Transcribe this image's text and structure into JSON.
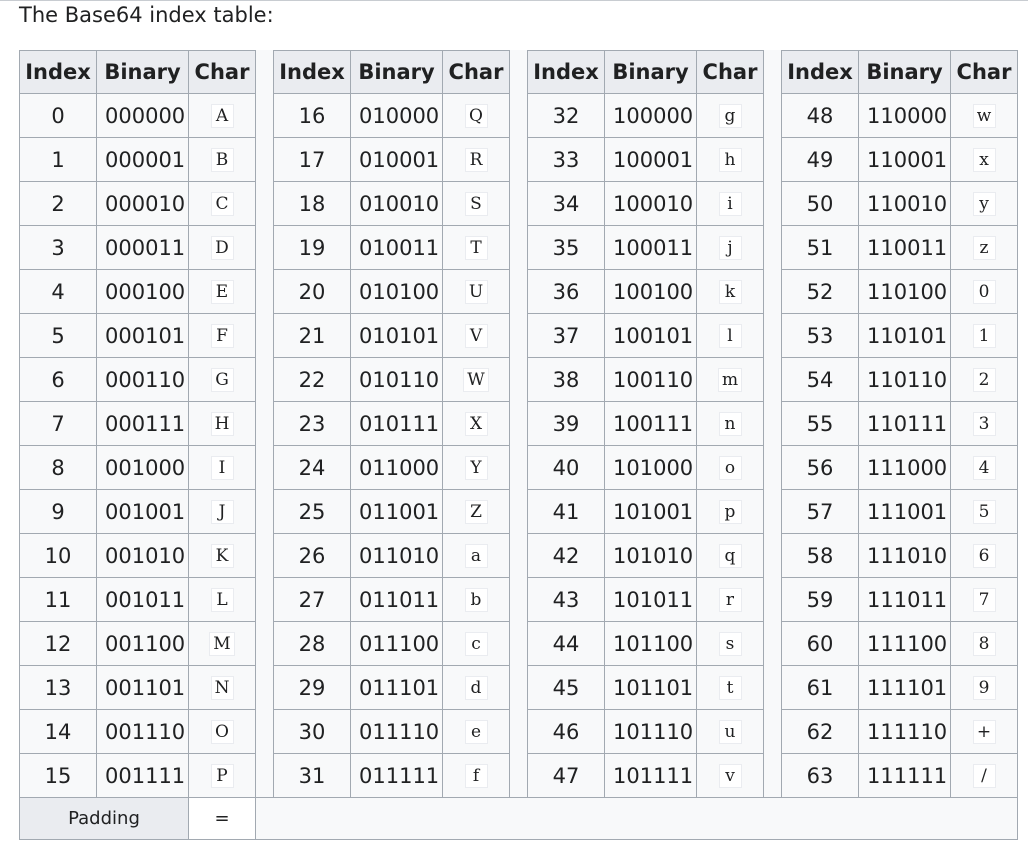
{
  "intro": "The Base64 index table:",
  "headers": {
    "index": "Index",
    "binary": "Binary",
    "char": "Char"
  },
  "rows": [
    [
      [
        "0",
        "000000",
        "A"
      ],
      [
        "16",
        "010000",
        "Q"
      ],
      [
        "32",
        "100000",
        "g"
      ],
      [
        "48",
        "110000",
        "w"
      ]
    ],
    [
      [
        "1",
        "000001",
        "B"
      ],
      [
        "17",
        "010001",
        "R"
      ],
      [
        "33",
        "100001",
        "h"
      ],
      [
        "49",
        "110001",
        "x"
      ]
    ],
    [
      [
        "2",
        "000010",
        "C"
      ],
      [
        "18",
        "010010",
        "S"
      ],
      [
        "34",
        "100010",
        "i"
      ],
      [
        "50",
        "110010",
        "y"
      ]
    ],
    [
      [
        "3",
        "000011",
        "D"
      ],
      [
        "19",
        "010011",
        "T"
      ],
      [
        "35",
        "100011",
        "j"
      ],
      [
        "51",
        "110011",
        "z"
      ]
    ],
    [
      [
        "4",
        "000100",
        "E"
      ],
      [
        "20",
        "010100",
        "U"
      ],
      [
        "36",
        "100100",
        "k"
      ],
      [
        "52",
        "110100",
        "0"
      ]
    ],
    [
      [
        "5",
        "000101",
        "F"
      ],
      [
        "21",
        "010101",
        "V"
      ],
      [
        "37",
        "100101",
        "l"
      ],
      [
        "53",
        "110101",
        "1"
      ]
    ],
    [
      [
        "6",
        "000110",
        "G"
      ],
      [
        "22",
        "010110",
        "W"
      ],
      [
        "38",
        "100110",
        "m"
      ],
      [
        "54",
        "110110",
        "2"
      ]
    ],
    [
      [
        "7",
        "000111",
        "H"
      ],
      [
        "23",
        "010111",
        "X"
      ],
      [
        "39",
        "100111",
        "n"
      ],
      [
        "55",
        "110111",
        "3"
      ]
    ],
    [
      [
        "8",
        "001000",
        "I"
      ],
      [
        "24",
        "011000",
        "Y"
      ],
      [
        "40",
        "101000",
        "o"
      ],
      [
        "56",
        "111000",
        "4"
      ]
    ],
    [
      [
        "9",
        "001001",
        "J"
      ],
      [
        "25",
        "011001",
        "Z"
      ],
      [
        "41",
        "101001",
        "p"
      ],
      [
        "57",
        "111001",
        "5"
      ]
    ],
    [
      [
        "10",
        "001010",
        "K"
      ],
      [
        "26",
        "011010",
        "a"
      ],
      [
        "42",
        "101010",
        "q"
      ],
      [
        "58",
        "111010",
        "6"
      ]
    ],
    [
      [
        "11",
        "001011",
        "L"
      ],
      [
        "27",
        "011011",
        "b"
      ],
      [
        "43",
        "101011",
        "r"
      ],
      [
        "59",
        "111011",
        "7"
      ]
    ],
    [
      [
        "12",
        "001100",
        "M"
      ],
      [
        "28",
        "011100",
        "c"
      ],
      [
        "44",
        "101100",
        "s"
      ],
      [
        "60",
        "111100",
        "8"
      ]
    ],
    [
      [
        "13",
        "001101",
        "N"
      ],
      [
        "29",
        "011101",
        "d"
      ],
      [
        "45",
        "101101",
        "t"
      ],
      [
        "61",
        "111101",
        "9"
      ]
    ],
    [
      [
        "14",
        "001110",
        "O"
      ],
      [
        "30",
        "011110",
        "e"
      ],
      [
        "46",
        "101110",
        "u"
      ],
      [
        "62",
        "111110",
        "+"
      ]
    ],
    [
      [
        "15",
        "001111",
        "P"
      ],
      [
        "31",
        "011111",
        "f"
      ],
      [
        "47",
        "101111",
        "v"
      ],
      [
        "63",
        "111111",
        "/"
      ]
    ]
  ],
  "padding": {
    "label": "Padding",
    "char": "="
  }
}
